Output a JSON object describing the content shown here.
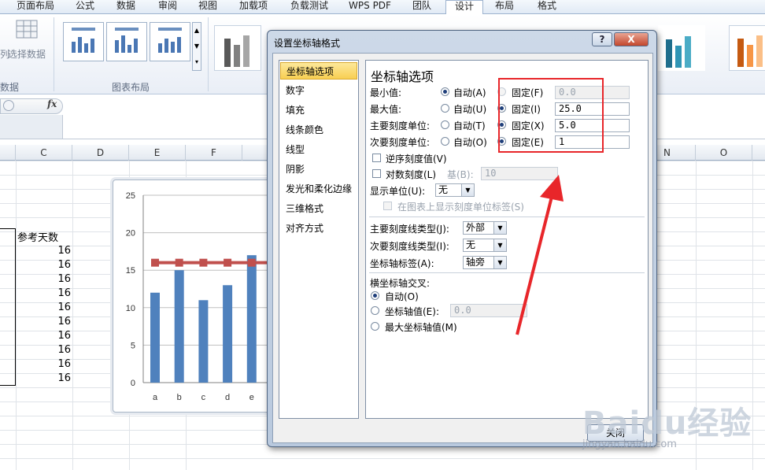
{
  "ribbon": {
    "tabs": [
      "页面布局",
      "公式",
      "数据",
      "审阅",
      "视图",
      "加载项",
      "负载测试",
      "WPS PDF",
      "团队",
      "设计",
      "布局",
      "格式"
    ],
    "active_tab": "设计",
    "select_data_label": "选择数据",
    "data_group_label": "数据",
    "chart_layouts_label": "图表布局"
  },
  "formula_bar": {
    "fx_label": "fx"
  },
  "sheet": {
    "column_headers": [
      "C",
      "D",
      "E",
      "F",
      "N",
      "O"
    ],
    "header_cell": "参考天数",
    "values": [
      "16",
      "16",
      "16",
      "16",
      "16",
      "16",
      "16",
      "16",
      "16",
      "16"
    ]
  },
  "chart_data": {
    "type": "bar",
    "categories": [
      "a",
      "b",
      "c",
      "d",
      "e"
    ],
    "series": [
      {
        "values": [
          12,
          15,
          11,
          13,
          17
        ],
        "color": "#4f81bd",
        "kind": "bar"
      },
      {
        "values": [
          16,
          16,
          16,
          16,
          16
        ],
        "color": "#c0504d",
        "kind": "line"
      }
    ],
    "y_ticks": [
      "0",
      "5",
      "10",
      "15",
      "20",
      "25"
    ],
    "ylim": [
      0,
      25
    ],
    "grid": true
  },
  "dialog": {
    "title": "设置坐标轴格式",
    "help_label": "?",
    "close_x_label": "X",
    "nav": [
      "坐标轴选项",
      "数字",
      "填充",
      "线条颜色",
      "线型",
      "阴影",
      "发光和柔化边缘",
      "三维格式",
      "对齐方式"
    ],
    "nav_selected": "坐标轴选项",
    "panel_title": "坐标轴选项",
    "rows": [
      {
        "label": "最小值:",
        "auto": "自动(A)",
        "fixed": "固定(F)",
        "value": "0.0"
      },
      {
        "label": "最大值:",
        "auto": "自动(U)",
        "fixed": "固定(I)",
        "value": "25.0"
      },
      {
        "label": "主要刻度单位:",
        "auto": "自动(T)",
        "fixed": "固定(X)",
        "value": "5.0"
      },
      {
        "label": "次要刻度单位:",
        "auto": "自动(O)",
        "fixed": "固定(E)",
        "value": "1"
      }
    ],
    "reverse_label": "逆序刻度值(V)",
    "log_label": "对数刻度(L)",
    "base_label": "基(B):",
    "base_value": "10",
    "display_unit_label": "显示单位(U):",
    "display_unit_value": "无",
    "show_unit_label": "在图表上显示刻度单位标签(S)",
    "major_tick_label": "主要刻度线类型(J):",
    "major_tick_value": "外部",
    "minor_tick_label": "次要刻度线类型(I):",
    "minor_tick_value": "无",
    "axis_label_label": "坐标轴标签(A):",
    "axis_label_value": "轴旁",
    "cross_title": "横坐标轴交叉:",
    "cross_auto": "自动(O)",
    "cross_value_label": "坐标轴值(E):",
    "cross_value": "0.0",
    "cross_max": "最大坐标轴值(M)",
    "close_button": "关闭"
  },
  "watermark": {
    "main": "Baidu经验",
    "sub": "jingyan.baidu.com"
  },
  "colors": {
    "annotation_red": "#e8262a",
    "selection_gold": "#f8cf52",
    "bar_blue": "#4f81bd",
    "line_red": "#c0504d"
  }
}
